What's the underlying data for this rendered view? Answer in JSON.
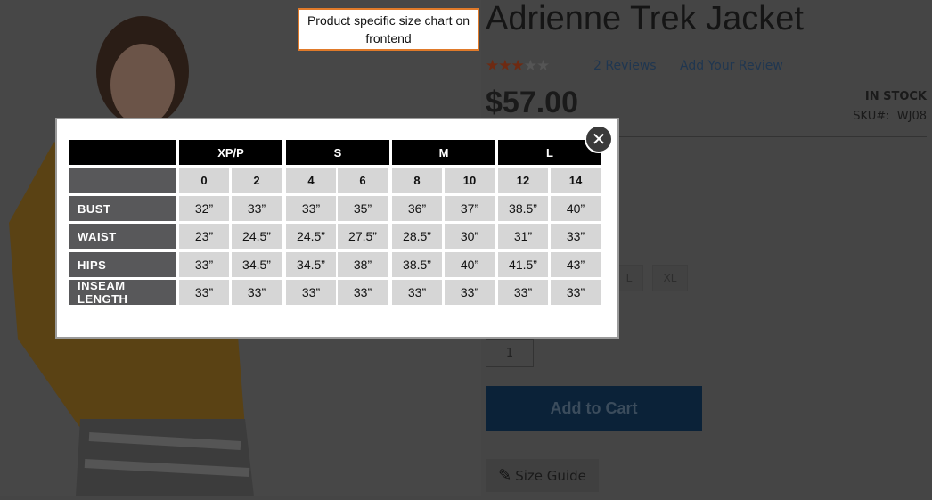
{
  "annotation": "Product specific size chart on frontend",
  "product": {
    "title": "Adrienne Trek Jacket",
    "rating": 3,
    "rating_max": 5,
    "reviews_link": "2 Reviews",
    "add_review_link": "Add Your Review",
    "price": "$57.00",
    "stock": "IN STOCK",
    "sku_label": "SKU#:",
    "sku": "WJ08"
  },
  "sizes": [
    "L",
    "XL"
  ],
  "quantity": "1",
  "add_to_cart": "Add to Cart",
  "size_guide": "Size Guide",
  "colors": {
    "accent": "#e07a2a",
    "cart": "#0b2238",
    "star": "#6e2a12"
  },
  "size_chart": {
    "groups": [
      "XP/P",
      "S",
      "M",
      "L"
    ],
    "sizes": [
      "0",
      "2",
      "4",
      "6",
      "8",
      "10",
      "12",
      "14"
    ],
    "rows": [
      {
        "label": "BUST",
        "values": [
          "32”",
          "33”",
          "33”",
          "35”",
          "36”",
          "37”",
          "38.5”",
          "40”"
        ]
      },
      {
        "label": "WAIST",
        "values": [
          "23”",
          "24.5”",
          "24.5”",
          "27.5”",
          "28.5”",
          "30”",
          "31”",
          "33”"
        ]
      },
      {
        "label": "HIPS",
        "values": [
          "33”",
          "34.5”",
          "34.5”",
          "38”",
          "38.5”",
          "40”",
          "41.5”",
          "43”"
        ]
      },
      {
        "label": "INSEAM LENGTH",
        "values": [
          "33”",
          "33”",
          "33”",
          "33”",
          "33”",
          "33”",
          "33”",
          "33”"
        ]
      }
    ]
  }
}
